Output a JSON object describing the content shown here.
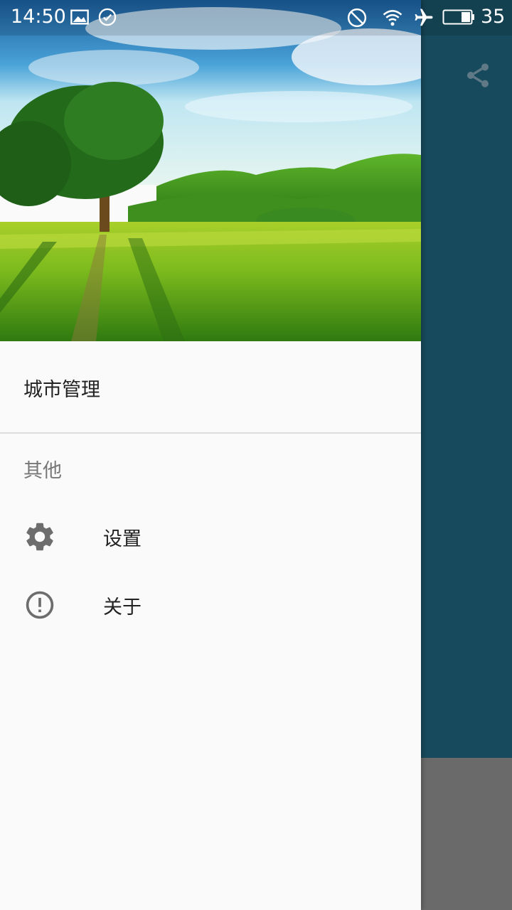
{
  "status_bar": {
    "time": "14:50",
    "battery_level": "35",
    "icons": [
      "image-icon",
      "check-circle-icon",
      "do-not-disturb-icon",
      "wifi-icon",
      "airplane-icon",
      "battery-icon"
    ]
  },
  "app_bar": {
    "share_icon": "share-icon"
  },
  "drawer": {
    "header_image": "landscape-field-tree-image",
    "items": [
      {
        "label": "城市管理"
      }
    ],
    "section_title": "其他",
    "other_items": [
      {
        "label": "设置",
        "icon": "gear-icon"
      },
      {
        "label": "关于",
        "icon": "info-circle-icon"
      }
    ]
  },
  "colors": {
    "app_background": "#174a5c",
    "drawer_background": "#fafafa",
    "icon_gray": "#6d6d6d"
  }
}
